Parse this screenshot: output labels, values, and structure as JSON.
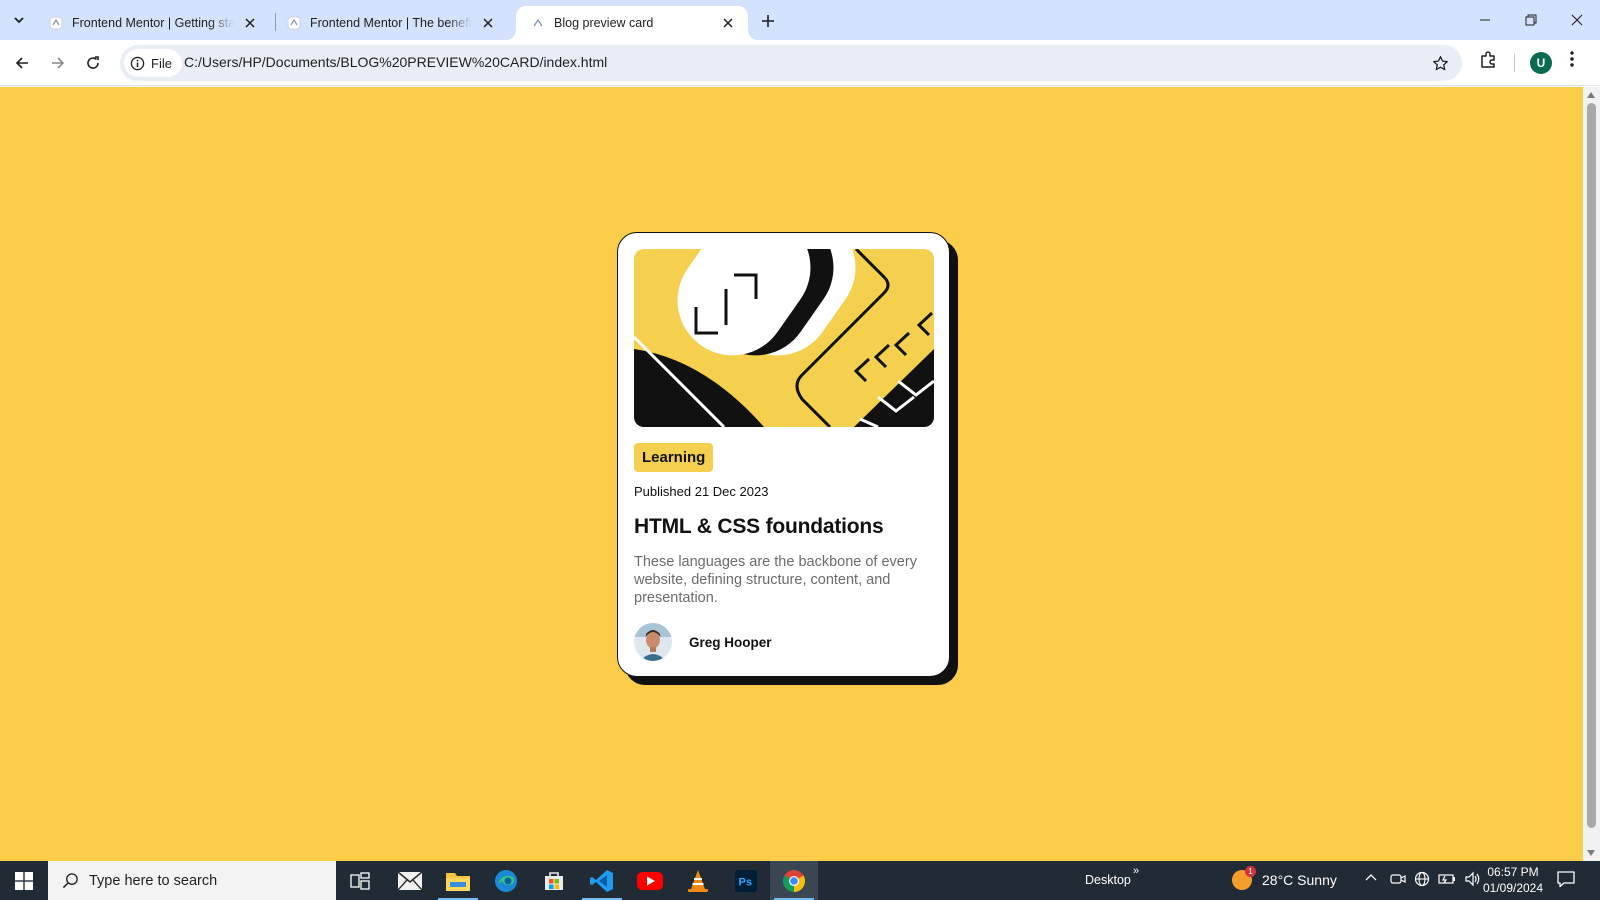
{
  "browser": {
    "tabs": [
      {
        "title": "Frontend Mentor | Getting started",
        "active": false
      },
      {
        "title": "Frontend Mentor | The benefits of",
        "active": false
      },
      {
        "title": "Blog preview card",
        "active": true
      }
    ],
    "chip_label": "File",
    "url": "C:/Users/HP/Documents/BLOG%20PREVIEW%20CARD/index.html",
    "profile_initial": "U"
  },
  "page": {
    "background": "#fccd4b",
    "card": {
      "tag": "Learning",
      "published": "Published 21 Dec 2023",
      "title": "HTML & CSS foundations",
      "description": "These languages are the backbone of every website, defining structure, content, and presentation.",
      "author": "Greg Hooper"
    }
  },
  "taskbar": {
    "search_placeholder": "Type here to search",
    "apps": [
      "task-view",
      "mail",
      "file-explorer",
      "edge",
      "microsoft-store",
      "vscode",
      "youtube",
      "vlc",
      "photoshop",
      "chrome"
    ],
    "desktop_label": "Desktop",
    "chevron": "»",
    "weather": "28°C  Sunny",
    "weather_badge": "1",
    "time": "06:57 PM",
    "date": "01/09/2024"
  }
}
